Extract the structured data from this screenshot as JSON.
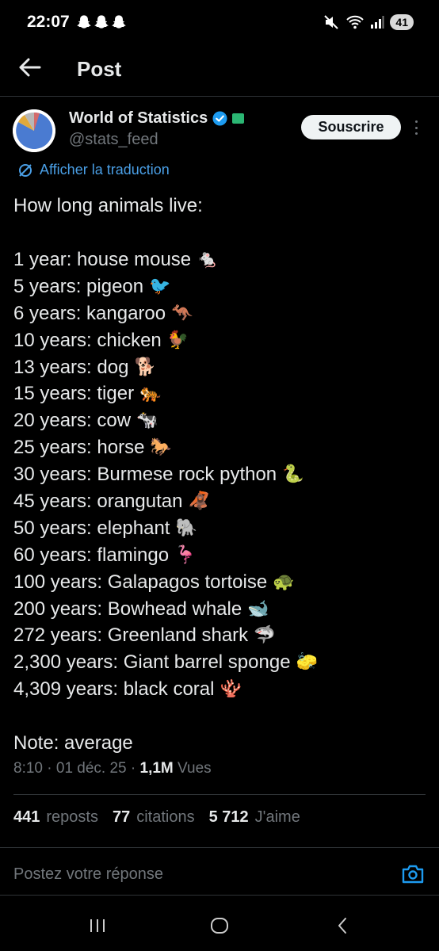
{
  "status_bar": {
    "time": "22:07",
    "battery": "41"
  },
  "header": {
    "title": "Post"
  },
  "author": {
    "name": "World of Statistics",
    "handle": "@stats_feed",
    "subscribe_label": "Souscrire"
  },
  "translate_label": "Afficher la traduction",
  "tweet": {
    "intro": "How long animals live:",
    "lines": [
      {
        "text": "1 year: house mouse",
        "emoji": "🐁"
      },
      {
        "text": "5 years: pigeon",
        "emoji": "🐦"
      },
      {
        "text": "6 years: kangaroo",
        "emoji": "🦘"
      },
      {
        "text": "10 years: chicken",
        "emoji": "🐓"
      },
      {
        "text": "13 years: dog",
        "emoji": "🐕"
      },
      {
        "text": "15 years: tiger",
        "emoji": "🐅"
      },
      {
        "text": "20 years: cow",
        "emoji": "🐄"
      },
      {
        "text": "25 years: horse",
        "emoji": "🐎"
      },
      {
        "text": "30 years: Burmese rock python",
        "emoji": "🐍"
      },
      {
        "text": "45 years: orangutan",
        "emoji": "🦧"
      },
      {
        "text": "50 years: elephant",
        "emoji": "🐘"
      },
      {
        "text": "60 years: flamingo",
        "emoji": "🦩"
      },
      {
        "text": "100 years: Galapagos tortoise",
        "emoji": "🐢"
      },
      {
        "text": "200 years: Bowhead whale",
        "emoji": "🐋"
      },
      {
        "text": "272 years: Greenland shark",
        "emoji": "🦈"
      },
      {
        "text": "2,300 years: Giant barrel sponge",
        "emoji": "🧽"
      },
      {
        "text": "4,309 years: black coral",
        "emoji": "🪸"
      }
    ],
    "note": "Note: average"
  },
  "meta": {
    "time": "8:10",
    "date": "01 déc. 25",
    "views_count": "1,1M",
    "views_label": "Vues"
  },
  "stats": {
    "reposts_count": "441",
    "reposts_label": "reposts",
    "quotes_count": "77",
    "quotes_label": "citations",
    "likes_count": "5 712",
    "likes_label": "J'aime"
  },
  "reply": {
    "placeholder": "Postez votre réponse"
  },
  "colors": {
    "accent": "#1d9bf0",
    "link": "#4a9fe6",
    "muted": "#71767b",
    "background": "#000000"
  },
  "icons": {
    "back": "arrow-left-icon",
    "verified": "verified-badge-icon",
    "affiliate": "affiliate-badge-icon",
    "translate": "translate-icon",
    "camera": "camera-icon",
    "more": "more-vertical-icon"
  }
}
